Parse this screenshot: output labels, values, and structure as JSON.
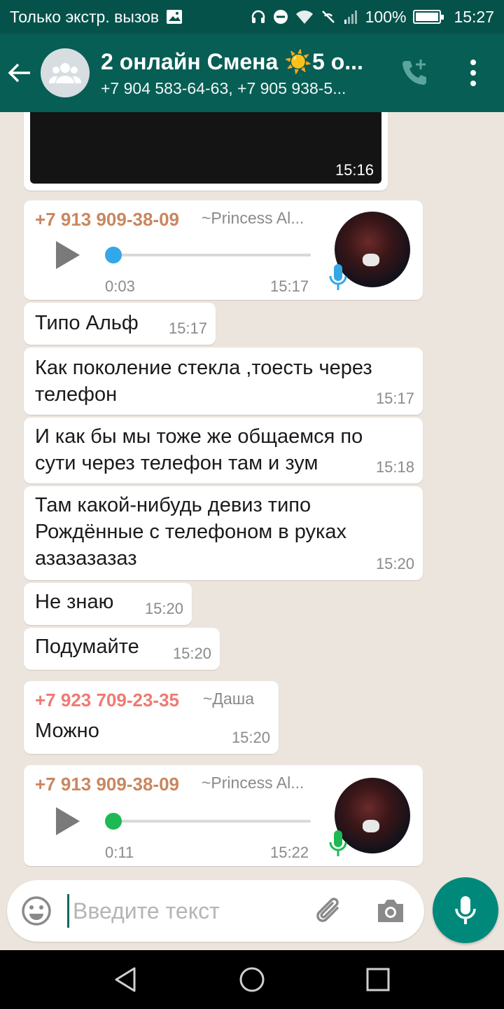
{
  "status_bar": {
    "carrier_text": "Только экстр. вызов",
    "battery": "100%",
    "time": "15:27"
  },
  "header": {
    "back_icon": "arrow-left-icon",
    "title": "2 онлайн Смена ☀️5 о...",
    "subtitle": "+7 904 583-64-63, +7 905 938-5...",
    "call_icon": "add-call-icon",
    "menu_icon": "more-vert-icon"
  },
  "messages": [
    {
      "type": "video",
      "time": "15:16"
    },
    {
      "type": "voice",
      "sender": "+7 913 909-38-09",
      "alias": "~Princess Al...",
      "duration": "0:03",
      "time": "15:17",
      "progress": 0,
      "played": false
    },
    {
      "type": "text",
      "text": "Типо Альф",
      "time": "15:17"
    },
    {
      "type": "text",
      "text": "Как поколение стекла ,тоесть через телефон",
      "line1": "Как поколение стекла ,тоесть через",
      "line2": "телефон",
      "time": "15:17"
    },
    {
      "type": "text",
      "line1": "И как бы мы тоже же общаемся по",
      "line2": "сути через телефон там и зум",
      "time": "15:18"
    },
    {
      "type": "text",
      "line1": "Там какой-нибудь девиз типо",
      "line2": "Рождённые с телефоном в руках",
      "line3": "азазазазаз",
      "time": "15:20"
    },
    {
      "type": "text",
      "text": "Не знаю",
      "time": "15:20"
    },
    {
      "type": "text",
      "text": "Подумайте",
      "time": "15:20"
    },
    {
      "type": "text",
      "sender": "+7 923 709-23-35",
      "alias": "~Даша",
      "text": "Можно",
      "time": "15:20"
    },
    {
      "type": "voice",
      "sender": "+7 913 909-38-09",
      "alias": "~Princess Al...",
      "duration": "0:11",
      "time": "15:22",
      "progress": 0,
      "played": true
    }
  ],
  "input": {
    "placeholder": "Введите текст",
    "value": ""
  },
  "colors": {
    "header": "#075e54",
    "status_bar": "#05524b",
    "sender_1": "#c9875f",
    "sender_2": "#f07a73",
    "voice_unplayed": "#34a7e8",
    "voice_played": "#1db954",
    "fab": "#00897b"
  }
}
